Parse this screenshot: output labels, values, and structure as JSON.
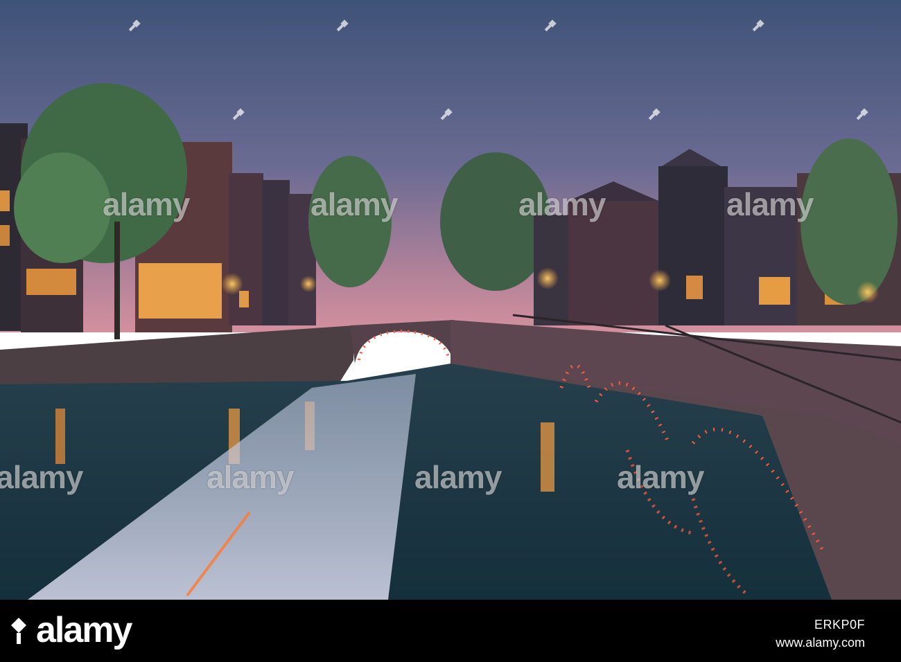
{
  "watermark": {
    "text": "alamy",
    "color": "#ffffff"
  },
  "footer": {
    "logo": "alamy",
    "image_id": "ERKP0F",
    "url": "www.alamy.com",
    "background": "#000000"
  },
  "colors": {
    "sky_top": "#45577a",
    "sky_bottom": "#c9879a",
    "water": "#1b3a46",
    "bridge_lights": "#ff5a3a",
    "window_glow": "#f0a23c"
  }
}
